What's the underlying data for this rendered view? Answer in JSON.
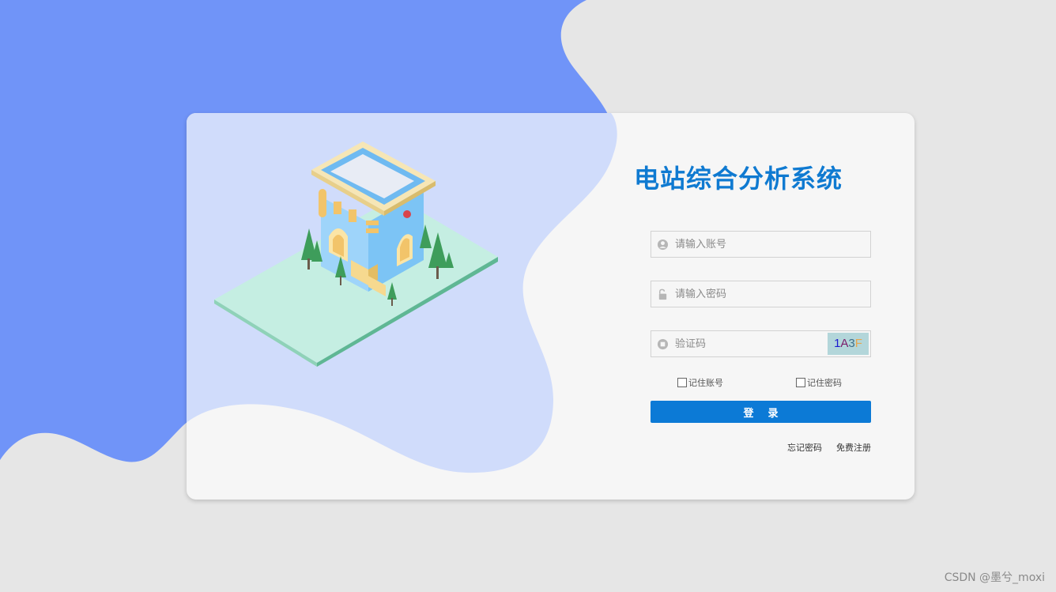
{
  "colors": {
    "accent": "#0c7ad6",
    "title": "#0f7ad1",
    "blob_dark": "#7094f8",
    "blob_light": "#d0dcfb",
    "page_bg": "#e6e6e6",
    "card_bg": "#f6f6f6"
  },
  "login": {
    "title": "电站综合分析系统",
    "username": {
      "placeholder": "请输入账号",
      "value": "",
      "icon": "user-circle-icon"
    },
    "password": {
      "placeholder": "请输入密码",
      "value": "",
      "icon": "unlock-icon"
    },
    "captcha_field": {
      "placeholder": "验证码",
      "value": "",
      "icon": "captcha-icon"
    },
    "captcha_chars": [
      {
        "char": "1",
        "color": "#1a1ad0"
      },
      {
        "char": "A",
        "color": "#7b1b6a"
      },
      {
        "char": "3",
        "color": "#3f6f8a"
      },
      {
        "char": "F",
        "color": "#e7a64d"
      }
    ],
    "remember_account": {
      "label": "记住账号",
      "checked": false
    },
    "remember_password": {
      "label": "记住密码",
      "checked": false
    },
    "submit_label": "登    录",
    "forgot_link": "忘记密码",
    "register_link": "免费注册"
  },
  "watermark": "CSDN @墨兮_moxi"
}
